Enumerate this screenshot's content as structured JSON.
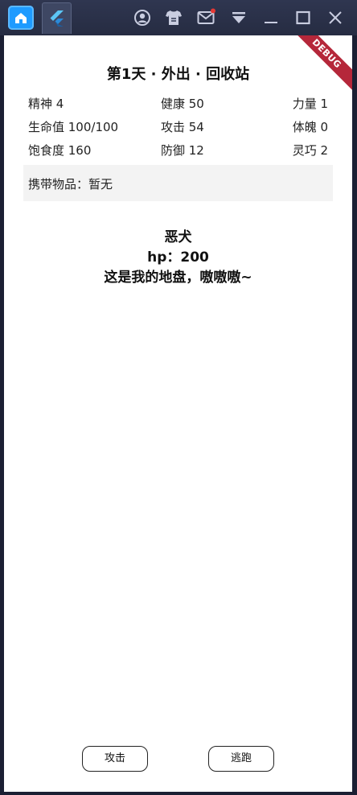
{
  "header": {
    "title": "第1天 · 外出 · 回收站",
    "debug_label": "DEBUG"
  },
  "stats": {
    "spirit": "精神 4",
    "health": "健康 50",
    "strength": "力量 1",
    "hp": "生命值 100/100",
    "attack": "攻击 54",
    "physique": "体魄 0",
    "satiety": "饱食度 160",
    "defense": "防御 12",
    "agility": "灵巧 2"
  },
  "inventory": {
    "label": "携带物品：暂无"
  },
  "enemy": {
    "name": "恶犬",
    "hp": "hp：200",
    "taunt": "这是我的地盘，嗷嗷嗷~"
  },
  "actions": {
    "attack_label": "攻击",
    "flee_label": "逃跑"
  },
  "colors": {
    "window_frame": "#2f3650",
    "home_accent": "#1e9bff",
    "debug_ribbon": "#b5273a",
    "notification_dot": "#e53935"
  }
}
